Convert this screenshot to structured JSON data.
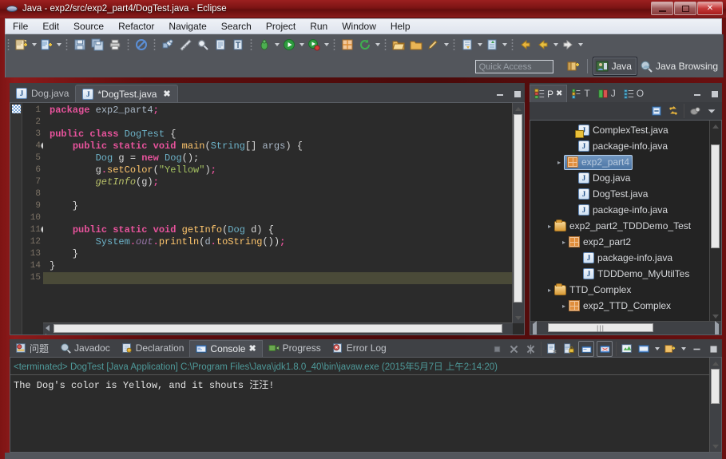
{
  "window": {
    "title": "Java - exp2/src/exp2_part4/DogTest.java - Eclipse",
    "app_icon": "eclipse-icon",
    "minimize_label": "–",
    "maximize_label": "□",
    "close_label": "✕"
  },
  "menu": {
    "items": [
      {
        "label": "File"
      },
      {
        "label": "Edit"
      },
      {
        "label": "Source"
      },
      {
        "label": "Refactor"
      },
      {
        "label": "Navigate"
      },
      {
        "label": "Search"
      },
      {
        "label": "Project"
      },
      {
        "label": "Run"
      },
      {
        "label": "Window"
      },
      {
        "label": "Help"
      }
    ]
  },
  "toolbar": {
    "groups": [
      {
        "buttons": [
          {
            "icon": "new-wizard-icon",
            "dropdown": true
          },
          {
            "icon": "new-java-class-icon",
            "dropdown": true
          }
        ]
      },
      {
        "buttons": [
          {
            "icon": "save-icon",
            "dropdown": false
          },
          {
            "icon": "save-all-icon",
            "dropdown": false
          },
          {
            "icon": "print-icon",
            "dropdown": false
          }
        ]
      },
      {
        "buttons": [
          {
            "icon": "no-entry-icon",
            "dropdown": false
          }
        ]
      },
      {
        "buttons": [
          {
            "icon": "build-all-icon",
            "dropdown": false
          },
          {
            "icon": "ruler-icon",
            "dropdown": false
          },
          {
            "icon": "search-icon",
            "dropdown": false
          },
          {
            "icon": "open-task-icon",
            "dropdown": false
          },
          {
            "icon": "open-type-icon",
            "dropdown": false
          }
        ]
      },
      {
        "buttons": [
          {
            "icon": "debug-icon",
            "dropdown": true
          },
          {
            "icon": "run-icon",
            "dropdown": true
          },
          {
            "icon": "run-coverage-icon",
            "dropdown": true
          }
        ]
      },
      {
        "buttons": [
          {
            "icon": "new-package-icon",
            "dropdown": false
          },
          {
            "icon": "refresh-icon",
            "dropdown": true
          }
        ]
      },
      {
        "buttons": [
          {
            "icon": "open-folder-icon",
            "dropdown": false
          },
          {
            "icon": "folder-icon",
            "dropdown": false
          },
          {
            "icon": "pencil-icon",
            "dropdown": true
          }
        ]
      },
      {
        "buttons": [
          {
            "icon": "next-annotation-icon",
            "dropdown": true
          },
          {
            "icon": "previous-annotation-icon",
            "dropdown": true
          }
        ]
      },
      {
        "buttons": [
          {
            "icon": "back-yellow-icon",
            "dropdown": false
          },
          {
            "icon": "back-icon",
            "dropdown": true
          },
          {
            "icon": "forward-icon",
            "dropdown": true
          }
        ]
      }
    ]
  },
  "quick_access": {
    "placeholder": "Quick Access",
    "open_perspective_icon": "open-perspective-icon",
    "perspectives": [
      {
        "label": "Java",
        "icon": "java-perspective-icon",
        "active": true
      },
      {
        "label": "Java Browsing",
        "icon": "java-browsing-perspective-icon",
        "active": false
      }
    ]
  },
  "editor": {
    "tabs": [
      {
        "label": "Dog.java",
        "icon": "java-file-icon",
        "active": false,
        "dirty": false,
        "closable": false
      },
      {
        "label": "*DogTest.java",
        "icon": "java-file-icon",
        "active": true,
        "dirty": true,
        "closable": true,
        "close_label": "✖"
      }
    ],
    "view_buttons": [
      {
        "icon": "minimize-icon",
        "label": "—"
      },
      {
        "icon": "maximize-icon",
        "label": "▬"
      }
    ],
    "line_numbers": [
      "1",
      "2",
      "3",
      "4",
      "5",
      "6",
      "7",
      "8",
      "9",
      "10",
      "11",
      "12",
      "13",
      "14",
      "15"
    ],
    "folding_lines": [
      4,
      11
    ],
    "highlight_line": 15,
    "scroll": {
      "vertical_position": "top",
      "horizontal_position": "left"
    },
    "code_lines": [
      {
        "n": 1,
        "text": "package exp2_part4;"
      },
      {
        "n": 2,
        "text": ""
      },
      {
        "n": 3,
        "text": "public class DogTest {"
      },
      {
        "n": 4,
        "text": "    public static void main(String[] args) {"
      },
      {
        "n": 5,
        "text": "        Dog g = new Dog();"
      },
      {
        "n": 6,
        "text": "        g.setColor(\"Yellow\");"
      },
      {
        "n": 7,
        "text": "        getInfo(g);"
      },
      {
        "n": 8,
        "text": ""
      },
      {
        "n": 9,
        "text": "    }"
      },
      {
        "n": 10,
        "text": ""
      },
      {
        "n": 11,
        "text": "    public static void getInfo(Dog d) {"
      },
      {
        "n": 12,
        "text": "        System.out.println(d.toString());"
      },
      {
        "n": 13,
        "text": "    }"
      },
      {
        "n": 14,
        "text": "}"
      },
      {
        "n": 15,
        "text": ""
      }
    ]
  },
  "package_explorer": {
    "tabs": [
      {
        "label": "P",
        "icon": "package-explorer-icon",
        "active": true,
        "close_label": "✖"
      },
      {
        "label": "T",
        "icon": "type-hierarchy-icon",
        "active": false
      },
      {
        "label": "J",
        "icon": "junit-icon",
        "active": false
      },
      {
        "label": "O",
        "icon": "outline-icon",
        "active": false
      }
    ],
    "view_buttons": [
      {
        "icon": "minimize-icon",
        "label": "—"
      },
      {
        "icon": "maximize-icon",
        "label": "▬"
      }
    ],
    "toolbar": [
      {
        "icon": "collapse-all-icon"
      },
      {
        "icon": "link-with-editor-icon"
      },
      {
        "icon": "focus-on-active-task-icon"
      },
      {
        "icon": "view-menu-icon"
      }
    ],
    "tree": [
      {
        "indent": 3,
        "icon": "java-file-icon",
        "label": "ComplexTest.java",
        "warning": true,
        "selected": false,
        "twisty": ""
      },
      {
        "indent": 3,
        "icon": "java-file-icon",
        "label": "package-info.java",
        "warning": false,
        "selected": false,
        "twisty": ""
      },
      {
        "indent": 2,
        "icon": "package-icon",
        "label": "exp2_part4",
        "warning": false,
        "selected": true,
        "twisty": "▸"
      },
      {
        "indent": 3,
        "icon": "java-file-icon",
        "label": "Dog.java",
        "warning": false,
        "selected": false,
        "twisty": ""
      },
      {
        "indent": 3,
        "icon": "java-file-icon",
        "label": "DogTest.java",
        "warning": false,
        "selected": false,
        "twisty": ""
      },
      {
        "indent": 3,
        "icon": "java-file-icon",
        "label": "package-info.java",
        "warning": false,
        "selected": false,
        "twisty": ""
      },
      {
        "indent": 1,
        "icon": "source-folder-icon",
        "label": "exp2_part2_TDDDemo_Test",
        "warning": false,
        "selected": false,
        "twisty": "▸"
      },
      {
        "indent": 2,
        "icon": "package-icon",
        "label": "exp2_part2",
        "warning": false,
        "selected": false,
        "twisty": "▸"
      },
      {
        "indent": 3,
        "icon": "java-file-icon",
        "label": "package-info.java",
        "warning": false,
        "selected": false,
        "twisty": ""
      },
      {
        "indent": 3,
        "icon": "java-file-icon",
        "label": "TDDDemo_MyUtilTes",
        "warning": false,
        "selected": false,
        "twisty": ""
      },
      {
        "indent": 1,
        "icon": "source-folder-icon",
        "label": "TTD_Complex",
        "warning": false,
        "selected": false,
        "twisty": "▸"
      },
      {
        "indent": 2,
        "icon": "package-icon",
        "label": "exp2_TTD_Complex",
        "warning": false,
        "selected": false,
        "twisty": "▸"
      }
    ],
    "hscroll_grip": "|||"
  },
  "console_panel": {
    "tabs": [
      {
        "label": "问题",
        "icon": "problems-icon",
        "active": false
      },
      {
        "label": "Javadoc",
        "icon": "javadoc-icon",
        "active": false
      },
      {
        "label": "Declaration",
        "icon": "declaration-icon",
        "active": false
      },
      {
        "label": "Console",
        "icon": "console-icon",
        "active": true,
        "close_label": "✖"
      },
      {
        "label": "Progress",
        "icon": "progress-icon",
        "active": false
      },
      {
        "label": "Error Log",
        "icon": "error-log-icon",
        "active": false
      }
    ],
    "toolbar": [
      {
        "icon": "terminate-icon",
        "enabled": false
      },
      {
        "icon": "remove-launch-icon",
        "enabled": false
      },
      {
        "icon": "remove-all-terminated-icon",
        "enabled": false
      },
      {
        "icon": "clear-console-icon",
        "enabled": true
      },
      {
        "icon": "scroll-lock-icon",
        "enabled": true
      },
      {
        "icon": "show-console-on-output-icon",
        "enabled": true,
        "framed": true
      },
      {
        "icon": "pin-console-icon",
        "enabled": true,
        "framed": true
      },
      {
        "icon": "display-selected-console-icon",
        "enabled": true
      },
      {
        "icon": "open-console-icon",
        "enabled": true,
        "dropdown": true
      },
      {
        "icon": "new-console-view-icon",
        "enabled": true,
        "dropdown": true
      },
      {
        "icon": "minimize-icon",
        "enabled": true
      },
      {
        "icon": "maximize-icon",
        "enabled": true
      }
    ],
    "header": "<terminated> DogTest [Java Application] C:\\Program Files\\Java\\jdk1.8.0_40\\bin\\javaw.exe (2015年5月7日 上午2:14:20)",
    "output": "The Dog's color is Yellow, and it shouts 汪汪!"
  },
  "colors": {
    "title_bar": "#7c1414",
    "accent_selection": "#3b6ea5",
    "editor_bg": "#2b2b2b",
    "panel_bg": "#3f4145",
    "keyword": "#cc7832",
    "string": "#a5c261",
    "method": "#ffc66d",
    "class": "#6db3c9",
    "console_header": "#4e9a9a"
  }
}
